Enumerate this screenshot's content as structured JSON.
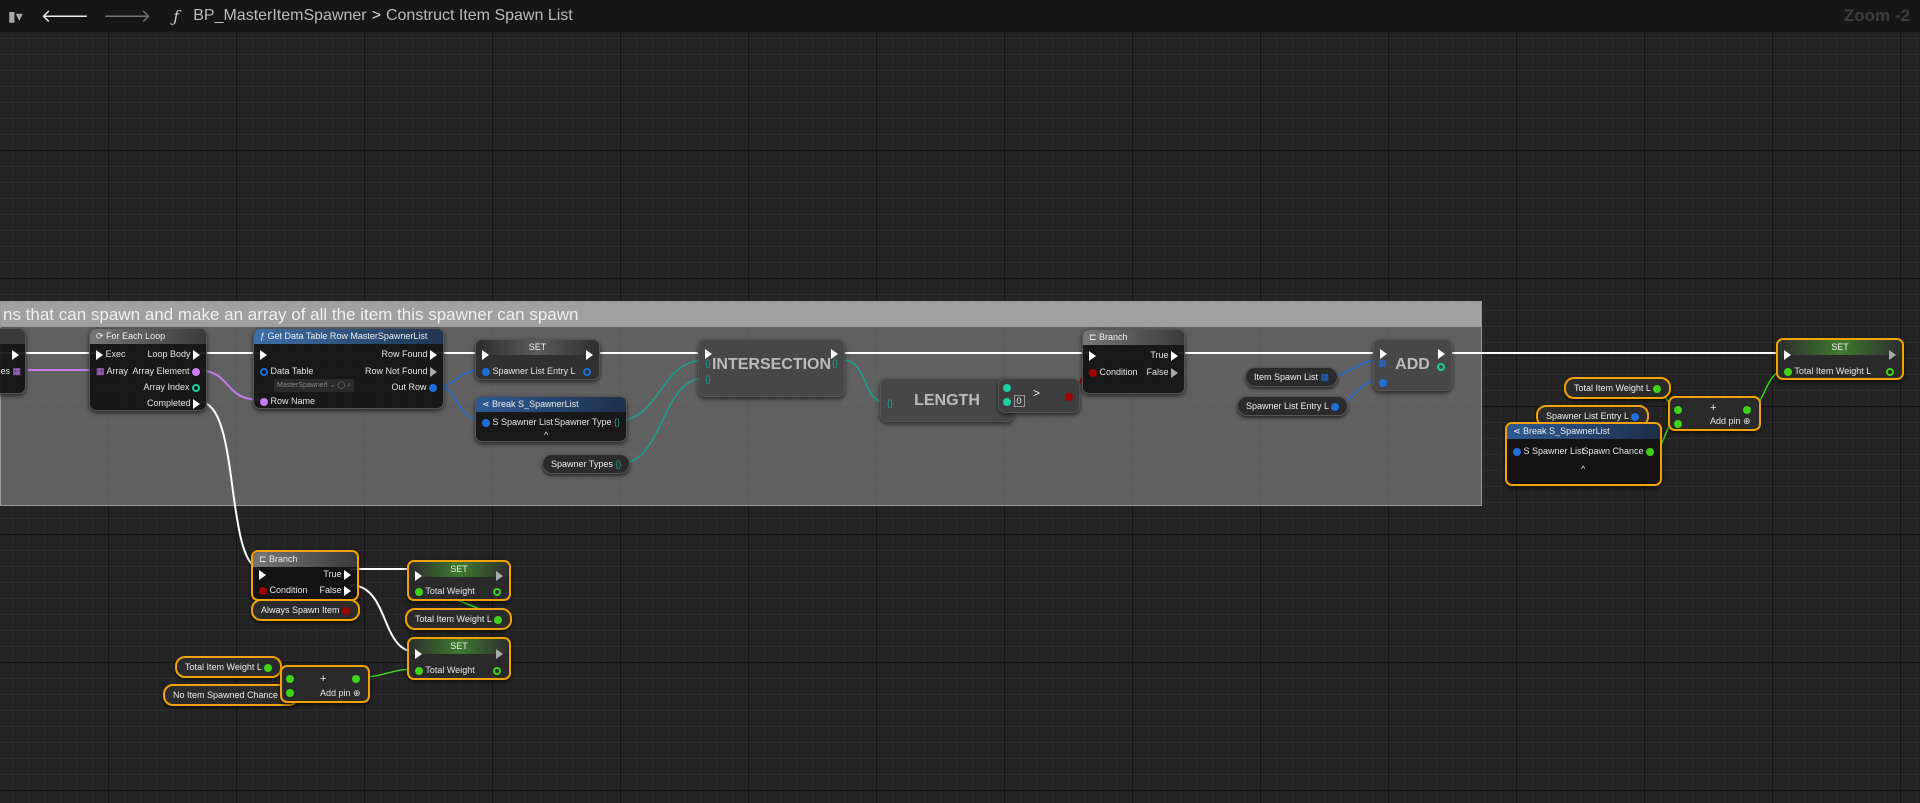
{
  "topbar": {
    "breadcrumb_parent": "BP_MasterItemSpawner",
    "breadcrumb_sep": ">",
    "breadcrumb_current": "Construct Item Spawn List",
    "function_icon": "ƒ",
    "zoom": "Zoom -2"
  },
  "comment": "ns that can spawn and make an array of all the item this spawner can spawn",
  "left_node": {
    "pin": "mes"
  },
  "foreach": {
    "title": "For Each Loop",
    "exec": "Exec",
    "array": "Array",
    "loop_body": "Loop Body",
    "array_element": "Array Element",
    "array_index": "Array Index",
    "completed": "Completed"
  },
  "getrow": {
    "title": "Get Data Table Row MasterSpawnerList",
    "data_table": "Data Table",
    "data_table_value": "MasterSpawnerl",
    "row_name": "Row Name",
    "row_found": "Row Found",
    "row_not_found": "Row Not Found",
    "out_row": "Out Row"
  },
  "set1": {
    "title": "SET",
    "pin": "Spawner List Entry L"
  },
  "break1": {
    "title": "Break S_SpawnerList",
    "in": "S Spawner List",
    "out": "Spawner Type",
    "expand": "^"
  },
  "spawner_types": "Spawner Types",
  "intersection": "INTERSECTION",
  "length": "LENGTH",
  "greater": {
    "op": ">",
    "value": "0"
  },
  "branch1": {
    "title": "Branch",
    "condition": "Condition",
    "true": "True",
    "false": "False"
  },
  "item_spawn_list": "Item Spawn List",
  "spawner_list_entry": "Spawner List Entry L",
  "add": "ADD",
  "set2": {
    "title": "SET",
    "pin": "Total Item Weight L"
  },
  "total_item_weight": "Total Item Weight L",
  "spawner_list_entry2": "Spawner List Entry L",
  "break2": {
    "title": "Break S_SpawnerList",
    "in": "S Spawner List",
    "out": "Spawn Chance",
    "expand": "^"
  },
  "addpin1": {
    "plus": "+",
    "label": "Add pin"
  },
  "branch2": {
    "title": "Branch",
    "condition": "Condition",
    "true": "True",
    "false": "False"
  },
  "always_spawn": "Always Spawn Item",
  "set3": {
    "title": "SET",
    "pin": "Total Weight"
  },
  "total_item_weight3": "Total Item Weight L",
  "set4": {
    "title": "SET",
    "pin": "Total Weight"
  },
  "total_item_weight4": "Total Item Weight L",
  "no_item_chance": "No Item Spawned Chance",
  "addpin2": {
    "plus": "+",
    "label": "Add pin"
  },
  "colors": {
    "exec": "#ffffff",
    "struct": "#0a5ed8",
    "float": "#3fd41a",
    "bool": "#a10000",
    "name": "#c57bf2",
    "set": "#19a08a",
    "selected": "#f3a300"
  }
}
